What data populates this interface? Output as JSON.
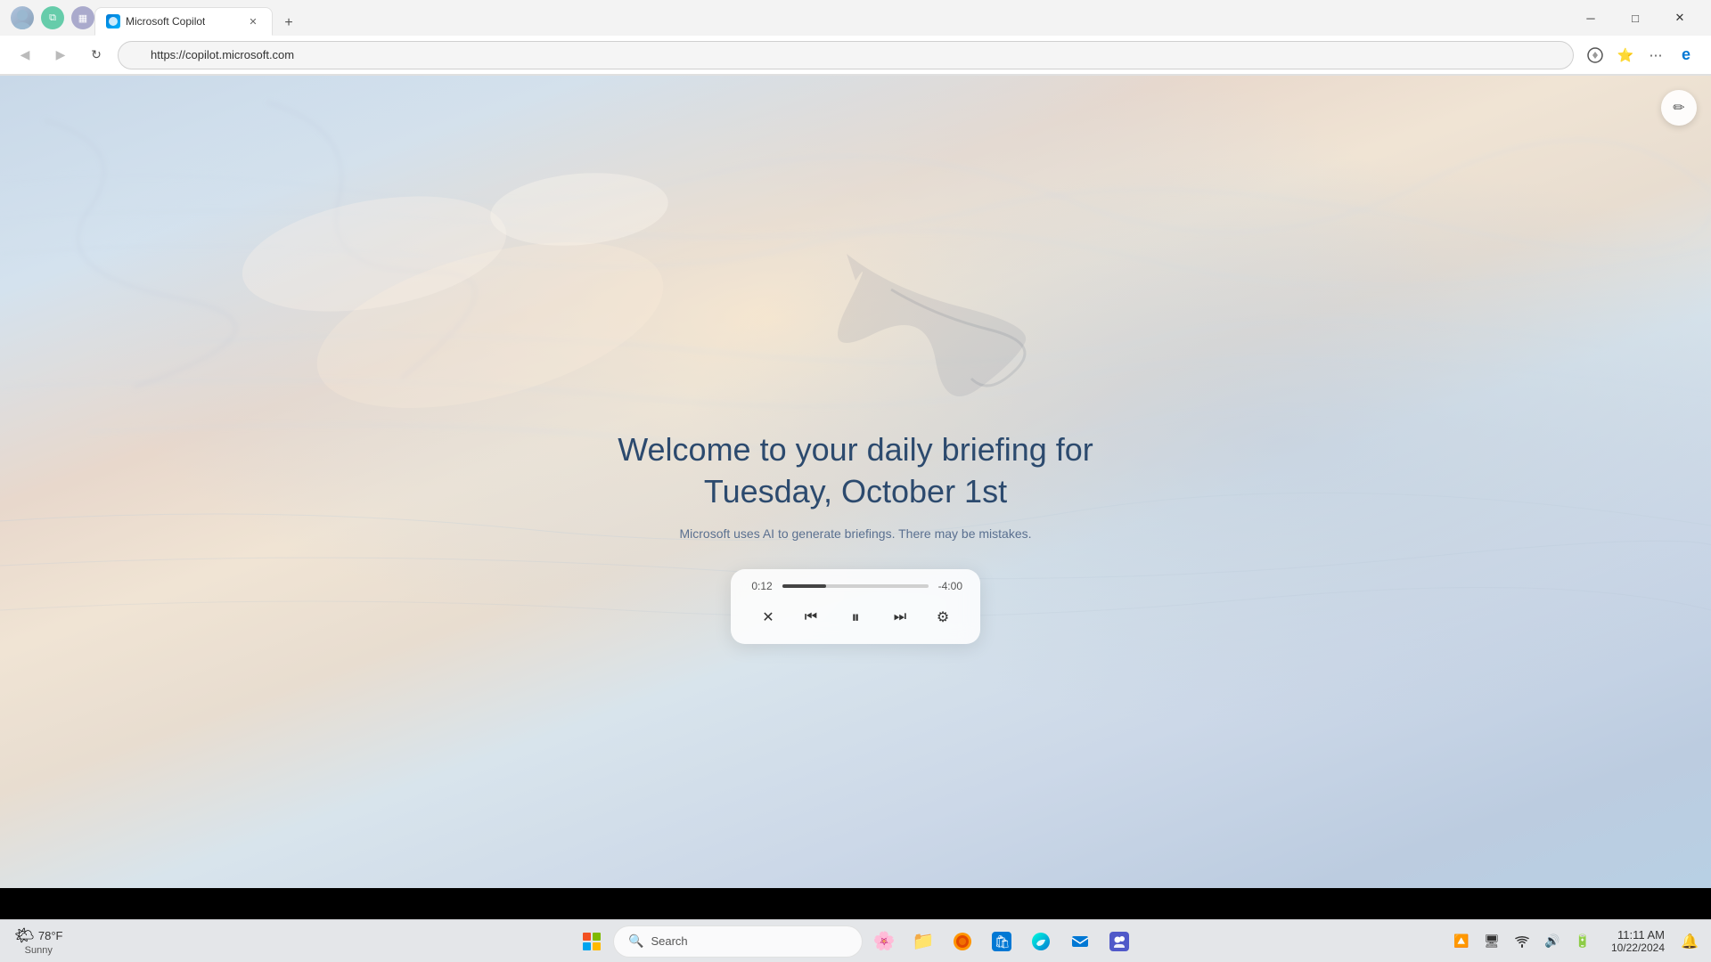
{
  "browser": {
    "title": "Microsoft Copilot",
    "url": "https://copilot.microsoft.com",
    "tab_label": "Microsoft Copilot",
    "back_btn": "◀",
    "forward_btn": "▶",
    "refresh_btn": "↻",
    "close_btn": "✕",
    "minimize_btn": "─",
    "maximize_btn": "□"
  },
  "page": {
    "welcome_line1": "Welcome to your daily briefing for",
    "welcome_line2": "Tuesday, October 1st",
    "ai_disclaimer": "Microsoft uses AI to generate briefings. There may be mistakes.",
    "edit_icon": "✏"
  },
  "player": {
    "current_time": "0:12",
    "remaining_time": "-4:00",
    "close_icon": "✕",
    "rewind_icon": "⏮",
    "pause_icon": "⏸",
    "next_icon": "⏭",
    "settings_icon": "⚙",
    "progress_percent": 30
  },
  "taskbar": {
    "search_placeholder": "Search",
    "search_icon": "🔍",
    "time": "11:11 AM",
    "date": "10/22/2024",
    "weather_temp": "78°F",
    "weather_cond": "Sunny",
    "weather_icon": "🌤",
    "start_colors": [
      "#f25022",
      "#7fba00",
      "#00a4ef",
      "#ffb900"
    ],
    "apps": [
      {
        "icon": "🌸",
        "name": "widgets"
      },
      {
        "icon": "📁",
        "name": "file-explorer"
      },
      {
        "icon": "🦊",
        "name": "firefox"
      },
      {
        "icon": "📦",
        "name": "store"
      },
      {
        "icon": "🌐",
        "name": "edge"
      },
      {
        "icon": "📧",
        "name": "mail"
      },
      {
        "icon": "💼",
        "name": "teams"
      }
    ],
    "tray_icons": [
      "🔼",
      "🖥",
      "📶",
      "🔊",
      "🔋"
    ]
  }
}
